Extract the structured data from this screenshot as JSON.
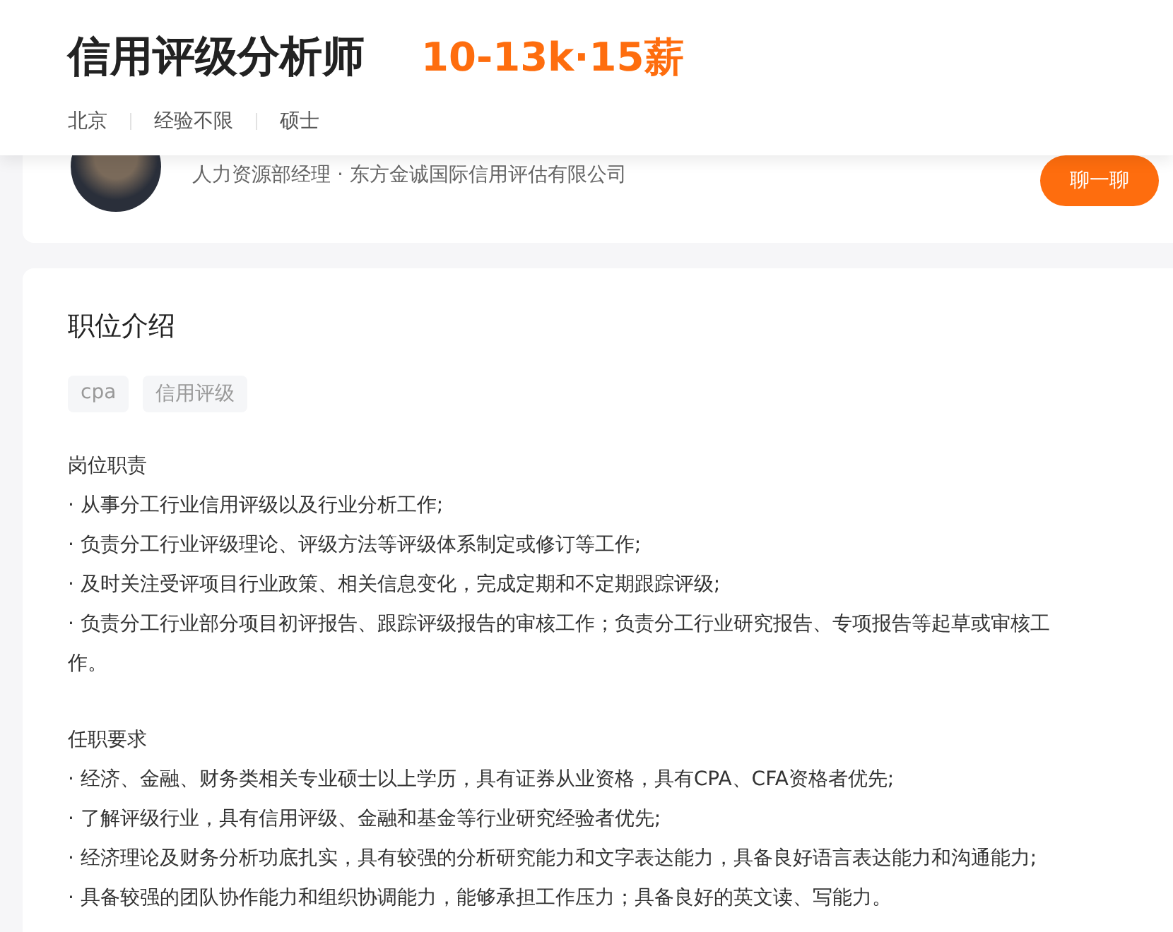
{
  "header": {
    "title": "信用评级分析师",
    "salary": "10-13k·15薪",
    "meta": [
      "北京",
      "经验不限",
      "硕士"
    ]
  },
  "recruiter": {
    "position_company": "人力资源部经理 · 东方金诚国际信用评估有限公司",
    "chat_button": "聊一聊"
  },
  "description": {
    "heading": "职位介绍",
    "tags": [
      "cpa",
      "信用评级"
    ],
    "sections": [
      {
        "heading": "岗位职责",
        "items": [
          "· 从事分工行业信用评级以及行业分析工作;",
          "· 负责分工行业评级理论、评级方法等评级体系制定或修订等工作;",
          "· 及时关注受评项目行业政策、相关信息变化，完成定期和不定期跟踪评级;",
          "· 负责分工行业部分项目初评报告、跟踪评级报告的审核工作；负责分工行业研究报告、专项报告等起草或审核工作。"
        ]
      },
      {
        "heading": "任职要求",
        "items": [
          "· 经济、金融、财务类相关专业硕士以上学历，具有证券从业资格，具有CPA、CFA资格者优先;",
          "· 了解评级行业，具有信用评级、金融和基金等行业研究经验者优先;",
          "· 经济理论及财务分析功底扎实，具有较强的分析研究能力和文字表达能力，具备良好语言表达能力和沟通能力;",
          "· 具备较强的团队协作能力和组织协调能力，能够承担工作压力；具备良好的英文读、写能力。"
        ]
      }
    ]
  }
}
